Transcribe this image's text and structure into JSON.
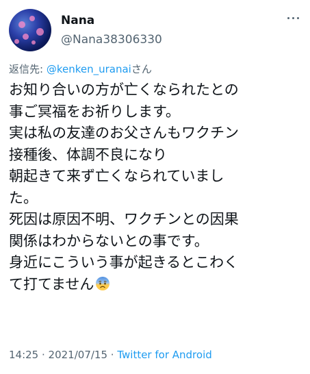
{
  "author": {
    "name": "Nana",
    "handle": "@Nana38306330"
  },
  "reply": {
    "prefix": "返信先: ",
    "mention": "@kenken_uranai",
    "suffix": "さん"
  },
  "tweet": {
    "lines": [
      "お知り合いの方が亡くなられたとの",
      "事ご冥福をお祈りします。",
      "実は私の友達のお父さんもワクチン",
      "接種後、体調不良になり",
      "朝起きて来ず亡くなられていまし",
      "た。",
      "死因は原因不明、ワクチンとの因果",
      "関係はわからないとの事です。",
      "身近にこういう事が起きるとこわく",
      "て打てません"
    ],
    "emoji": "anxious-face-with-sweat"
  },
  "meta": {
    "time": "14:25",
    "sep1": " · ",
    "date": "2021/07/15",
    "sep2": " · ",
    "source": "Twitter for Android"
  },
  "colors": {
    "text": "#0f1419",
    "secondary": "#536471",
    "link": "#1d9bf0"
  },
  "icons": {
    "more": "more-horizontal-icon",
    "avatar": "jellyfish-avatar"
  }
}
